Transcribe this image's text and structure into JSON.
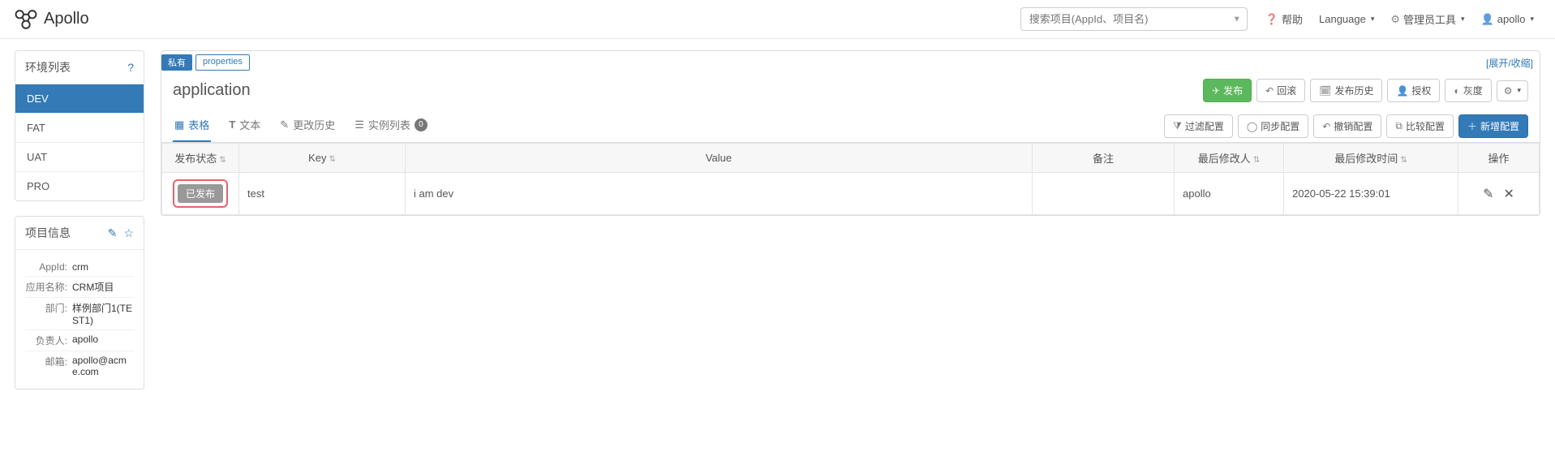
{
  "brand": "Apollo",
  "search": {
    "placeholder": "搜索项目(AppId、项目名)"
  },
  "nav": {
    "help": "帮助",
    "language": "Language",
    "admin": "管理员工具",
    "user": "apollo"
  },
  "env_panel": {
    "title": "环境列表",
    "items": [
      "DEV",
      "FAT",
      "UAT",
      "PRO"
    ],
    "active": 0
  },
  "info_panel": {
    "title": "项目信息",
    "rows": [
      {
        "label": "AppId:",
        "value": "crm"
      },
      {
        "label": "应用名称:",
        "value": "CRM项目"
      },
      {
        "label": "部门:",
        "value": "样例部门1(TEST1)"
      },
      {
        "label": "负责人:",
        "value": "apollo"
      },
      {
        "label": "邮箱:",
        "value": "apollo@acme.com"
      }
    ]
  },
  "namespace": {
    "tags": {
      "private": "私有",
      "props": "properties"
    },
    "expand": "[展开/收缩]",
    "name": "application",
    "buttons": {
      "publish": "发布",
      "rollback": "回滚",
      "history": "发布历史",
      "auth": "授权",
      "gray": "灰度"
    },
    "subtabs": {
      "grid": "表格",
      "text": "文本",
      "changes": "更改历史",
      "instances": "实例列表",
      "instances_count": "0"
    },
    "toolbar": {
      "filter": "过滤配置",
      "sync": "同步配置",
      "revoke": "撤销配置",
      "compare": "比较配置",
      "add": "新增配置"
    },
    "columns": {
      "status": "发布状态",
      "key": "Key",
      "value": "Value",
      "remark": "备注",
      "modifier": "最后修改人",
      "time": "最后修改时间",
      "ops": "操作"
    },
    "rows": [
      {
        "status": "已发布",
        "key": "test",
        "value": "i am dev",
        "remark": "",
        "modifier": "apollo",
        "time": "2020-05-22 15:39:01"
      }
    ]
  }
}
